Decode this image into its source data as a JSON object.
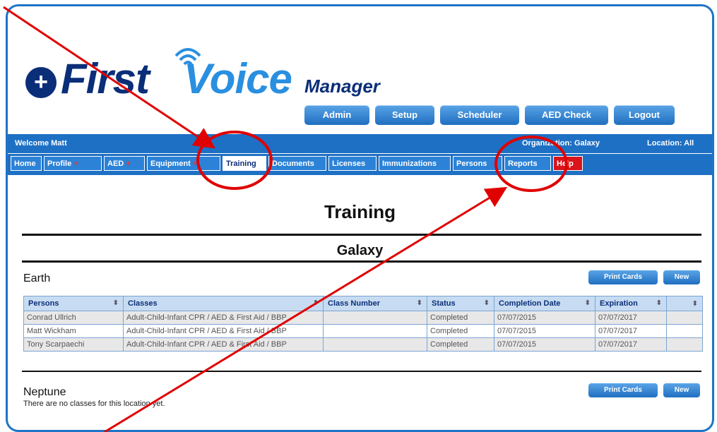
{
  "brand": {
    "logo_first": "First",
    "logo_voice": "Voice",
    "logo_manager": "Manager"
  },
  "topnav": [
    {
      "label": "Admin"
    },
    {
      "label": "Setup"
    },
    {
      "label": "Scheduler"
    },
    {
      "label": "AED Check"
    },
    {
      "label": "Logout"
    }
  ],
  "infobar": {
    "welcome": "Welcome Matt",
    "organization": "Organization: Galaxy",
    "location": "Location: All"
  },
  "tabs": [
    {
      "label": "Home"
    },
    {
      "label": "Profile",
      "plus": "+"
    },
    {
      "label": "AED",
      "plus": "+"
    },
    {
      "label": "Equipment",
      "plus": "+"
    },
    {
      "label": "Training"
    },
    {
      "label": "Documents"
    },
    {
      "label": "Licenses"
    },
    {
      "label": "Immunizations"
    },
    {
      "label": "Persons"
    },
    {
      "label": "Reports"
    },
    {
      "label": "Help"
    }
  ],
  "page": {
    "title": "Training",
    "subtitle": "Galaxy"
  },
  "earth": {
    "name": "Earth",
    "print_cards": "Print Cards",
    "new": "New",
    "columns": [
      "Persons",
      "Classes",
      "Class Number",
      "Status",
      "Completion Date",
      "Expiration",
      ""
    ],
    "rows": [
      [
        "Conrad Ullrich",
        "Adult-Child-Infant CPR / AED & First Aid / BBP",
        "",
        "Completed",
        "07/07/2015",
        "07/07/2017",
        ""
      ],
      [
        "Matt Wickham",
        "Adult-Child-Infant CPR / AED & First Aid / BBP",
        "",
        "Completed",
        "07/07/2015",
        "07/07/2017",
        ""
      ],
      [
        "Tony Scarpaechi",
        "Adult-Child-Infant CPR / AED & First Aid / BBP",
        "",
        "Completed",
        "07/07/2015",
        "07/07/2017",
        ""
      ]
    ]
  },
  "neptune": {
    "name": "Neptune",
    "message": "There are no classes for this location yet.",
    "print_cards": "Print Cards",
    "new": "New"
  },
  "annotation": {
    "color": "#e00000"
  }
}
